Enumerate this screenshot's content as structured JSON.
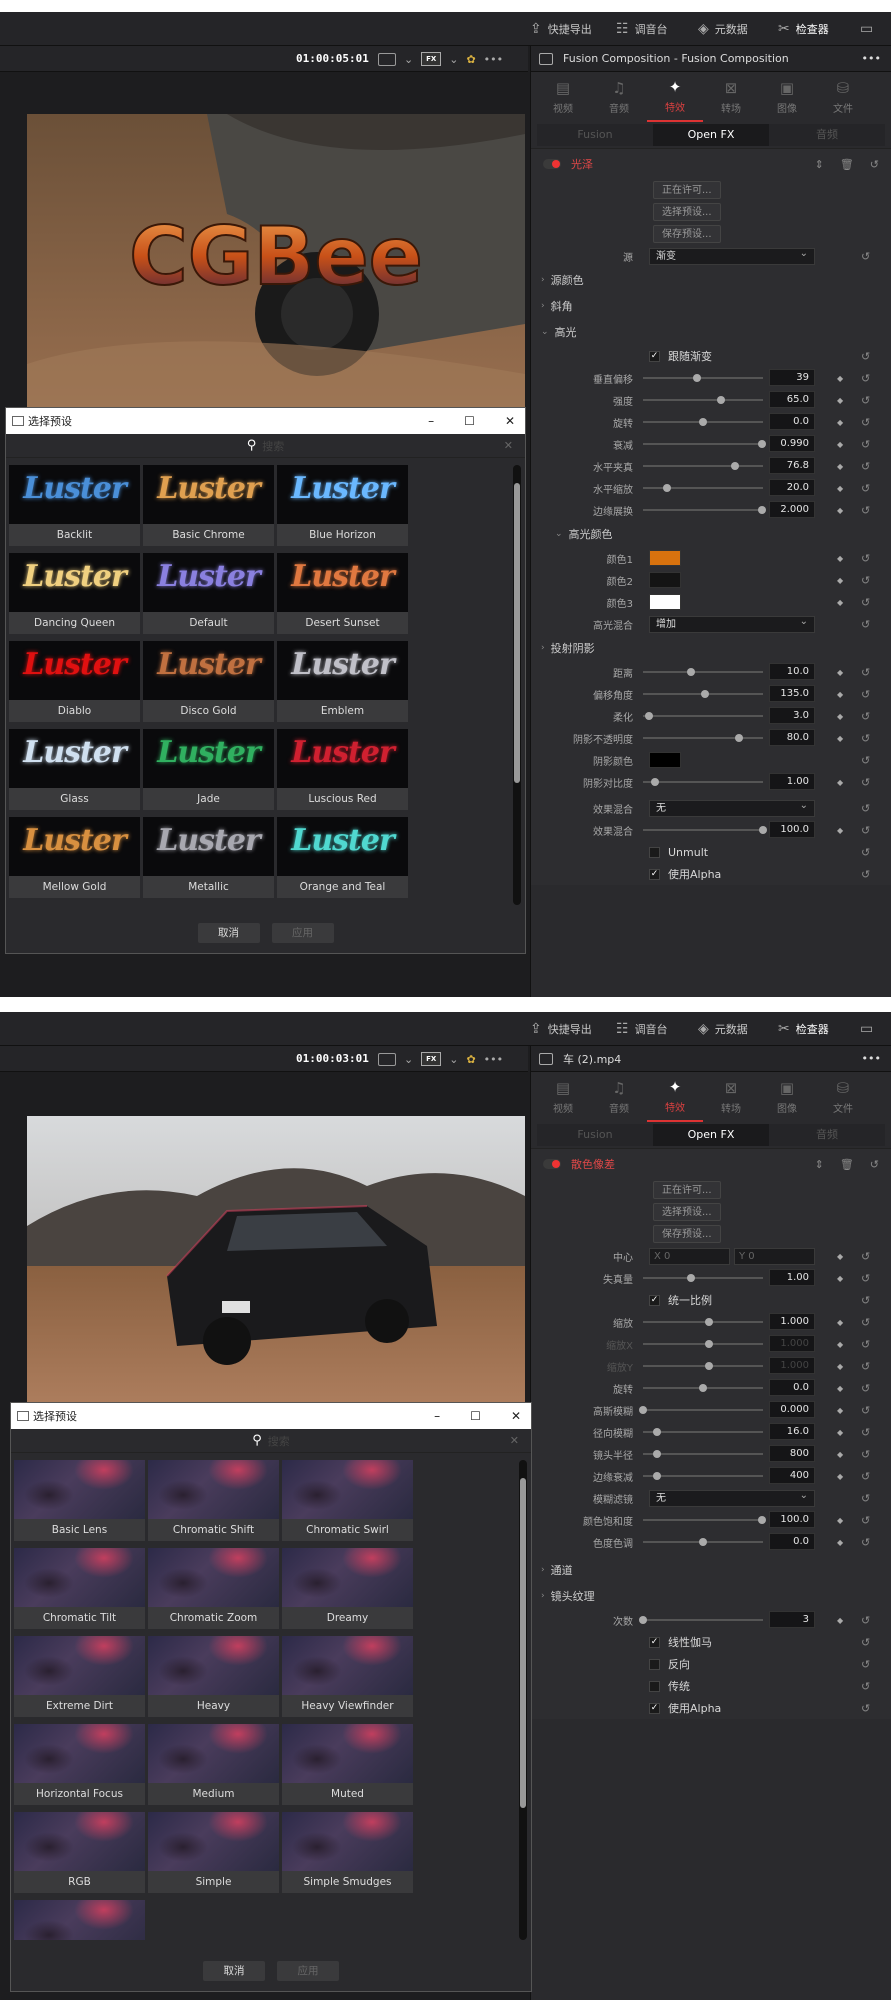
{
  "topbar": {
    "quick_export": "快捷导出",
    "color": "调音台",
    "metadata": "元数据",
    "inspector": "检查器"
  },
  "p1": {
    "timecode": "01:00:05:01",
    "clip_title": "Fusion Composition - Fusion Composition",
    "tabs": [
      "视频",
      "音频",
      "特效",
      "转场",
      "图像",
      "文件"
    ],
    "segments": [
      "Fusion",
      "Open FX",
      "音频"
    ],
    "effect_name": "光泽",
    "preset_buttons": [
      "正在许可...",
      "选择预设...",
      "保存预设..."
    ],
    "source_label": "源",
    "source_value": "渐变",
    "section_src_color": "源颜色",
    "section_bevel": "斜角",
    "section_highlight": "高光",
    "follow_gradient": "跟随渐变",
    "params": [
      {
        "label": "垂直偏移",
        "value": "39",
        "pos": 0.45
      },
      {
        "label": "强度",
        "value": "65.0",
        "pos": 0.65
      },
      {
        "label": "旋转",
        "value": "0.0",
        "pos": 0.5
      },
      {
        "label": "衰减",
        "value": "0.990",
        "pos": 0.99
      },
      {
        "label": "水平夹真",
        "value": "76.8",
        "pos": 0.77
      },
      {
        "label": "水平缩放",
        "value": "20.0",
        "pos": 0.2
      },
      {
        "label": "边缘展换",
        "value": "2.000",
        "pos": 0.99
      }
    ],
    "section_hl_color": "高光颜色",
    "colors": [
      {
        "label": "颜色1",
        "hex": "#d8720e"
      },
      {
        "label": "颜色2",
        "hex": "#141414"
      },
      {
        "label": "颜色3",
        "hex": "#ffffff"
      }
    ],
    "hl_blend_label": "高光混合",
    "hl_blend_value": "增加",
    "section_shadow": "投射阴影",
    "shadow_params": [
      {
        "label": "距离",
        "value": "10.0",
        "pos": 0.4
      },
      {
        "label": "偏移角度",
        "value": "135.0",
        "pos": 0.52
      },
      {
        "label": "柔化",
        "value": "3.0",
        "pos": 0.05
      },
      {
        "label": "阴影不透明度",
        "value": "80.0",
        "pos": 0.8
      }
    ],
    "shadow_color_label": "阴影颜色",
    "shadow_color": "#000000",
    "shadow_contrast": {
      "label": "阴影对比度",
      "value": "1.00",
      "pos": 0.1
    },
    "fx_blend_label": "效果混合",
    "fx_blend_value": "无",
    "fx_mix": {
      "label": "效果混合",
      "value": "100.0",
      "pos": 1.0
    },
    "unmult": "Unmult",
    "use_alpha": "使用Alpha",
    "dialog": {
      "title": "选择预设",
      "search": "搜索",
      "cancel": "取消",
      "apply": "应用",
      "presets": [
        "Backlit",
        "Basic Chrome",
        "Blue Horizon",
        "Dancing Queen",
        "Default",
        "Desert Sunset",
        "Diablo",
        "Disco Gold",
        "Emblem",
        "Glass",
        "Jade",
        "Luscious Red",
        "Mellow Gold",
        "Metallic",
        "Orange and Teal",
        "",
        "",
        ""
      ],
      "thumb_text": "Luster"
    }
  },
  "p2": {
    "timecode": "01:00:03:01",
    "clip_title": "车 (2).mp4",
    "tabs": [
      "视频",
      "音频",
      "特效",
      "转场",
      "图像",
      "文件"
    ],
    "segments": [
      "Fusion",
      "Open FX",
      "音频"
    ],
    "effect_name": "散色像差",
    "preset_buttons": [
      "正在许可...",
      "选择预设...",
      "保存预设..."
    ],
    "center_label": "中心",
    "center_x": "0",
    "center_y": "0",
    "x_label": "X",
    "y_label": "Y",
    "distortion": {
      "label": "失真量",
      "value": "1.00",
      "pos": 0.4
    },
    "uniform_scale": "统一比例",
    "scale_params": [
      {
        "label": "缩放",
        "value": "1.000",
        "pos": 0.55,
        "dim": false
      },
      {
        "label": "缩放X",
        "value": "1.000",
        "pos": 0.55,
        "dim": true
      },
      {
        "label": "缩放Y",
        "value": "1.000",
        "pos": 0.55,
        "dim": true
      },
      {
        "label": "旋转",
        "value": "0.0",
        "pos": 0.5,
        "dim": false
      },
      {
        "label": "高斯模糊",
        "value": "0.000",
        "pos": 0.0,
        "dim": false
      },
      {
        "label": "径向模糊",
        "value": "16.0",
        "pos": 0.12,
        "dim": false
      },
      {
        "label": "镜头半径",
        "value": "800",
        "pos": 0.12,
        "dim": false
      },
      {
        "label": "边缘衰减",
        "value": "400",
        "pos": 0.12,
        "dim": false
      }
    ],
    "blur_filter_label": "模糊滤镜",
    "blur_filter_value": "无",
    "sat_params": [
      {
        "label": "颜色饱和度",
        "value": "100.0",
        "pos": 0.99
      },
      {
        "label": "色度色调",
        "value": "0.0",
        "pos": 0.5
      }
    ],
    "section_channel": "通道",
    "section_lens": "镜头纹理",
    "iterations": {
      "label": "次数",
      "value": "3",
      "pos": 0.0
    },
    "checks": [
      {
        "label": "线性伽马",
        "checked": true
      },
      {
        "label": "反向",
        "checked": false
      },
      {
        "label": "传统",
        "checked": false
      },
      {
        "label": "使用Alpha",
        "checked": true
      }
    ],
    "dialog": {
      "title": "选择预设",
      "search": "搜索",
      "cancel": "取消",
      "apply": "应用",
      "presets": [
        "Basic Lens",
        "Chromatic Shift",
        "Chromatic Swirl",
        "Chromatic Tilt",
        "Chromatic Zoom",
        "Dreamy",
        "Extreme Dirt",
        "Heavy",
        "Heavy Viewfinder",
        "Horizontal Focus",
        "Medium",
        "Muted",
        "RGB",
        "Simple",
        "Simple Smudges",
        ""
      ]
    }
  },
  "thumb_colors": {
    "blue": "#4a8fd8",
    "chrome": "#e0a050",
    "horizon": "#6ab8ff",
    "queen": "#f0d080",
    "default": "#8a80e0",
    "desert": "#e07840",
    "diablo": "#e01010",
    "disco": "#c07040",
    "emblem": "#c0c0c8",
    "glass": "#d0e0f0",
    "jade": "#30b060",
    "red": "#d02030",
    "mellow": "#d89040",
    "metallic": "#a8a8b0",
    "teal": "#50d8d0",
    "p1": "#c050e0",
    "p2": "#f040c0",
    "p3": "#80d8f0"
  }
}
